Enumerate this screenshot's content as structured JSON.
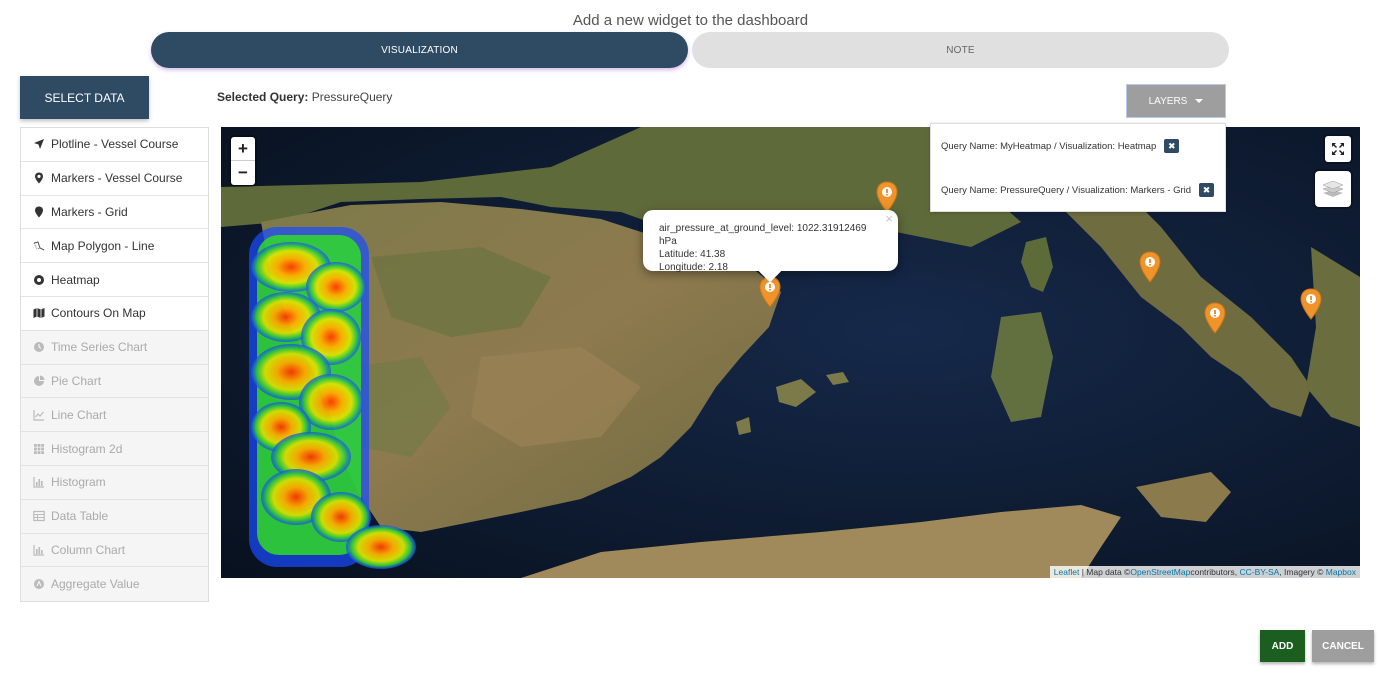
{
  "dialog": {
    "title": "Add a new widget to the dashboard"
  },
  "tabs": [
    {
      "label": "VISUALIZATION",
      "active": true
    },
    {
      "label": "NOTE",
      "active": false
    }
  ],
  "select_data_label": "SELECT DATA",
  "selected_query": {
    "label": "Selected Query:",
    "value": "PressureQuery"
  },
  "layers_button": {
    "label": "LAYERS"
  },
  "visualizations": [
    {
      "label": "Plotline - Vessel Course",
      "icon": "location-arrow-icon",
      "enabled": true
    },
    {
      "label": "Markers - Vessel Course",
      "icon": "map-marker-icon",
      "enabled": true
    },
    {
      "label": "Markers - Grid",
      "icon": "map-pin-icon",
      "enabled": true
    },
    {
      "label": "Map Polygon - Line",
      "icon": "polygon-icon",
      "enabled": true
    },
    {
      "label": "Heatmap",
      "icon": "dot-circle-icon",
      "enabled": true
    },
    {
      "label": "Contours On Map",
      "icon": "map-icon",
      "enabled": true
    },
    {
      "label": "Time Series Chart",
      "icon": "clock-icon",
      "enabled": false
    },
    {
      "label": "Pie Chart",
      "icon": "pie-chart-icon",
      "enabled": false
    },
    {
      "label": "Line Chart",
      "icon": "line-chart-icon",
      "enabled": false
    },
    {
      "label": "Histogram 2d",
      "icon": "grid-icon",
      "enabled": false
    },
    {
      "label": "Histogram",
      "icon": "bar-chart-icon",
      "enabled": false
    },
    {
      "label": "Data Table",
      "icon": "table-icon",
      "enabled": false
    },
    {
      "label": "Column Chart",
      "icon": "column-chart-icon",
      "enabled": false
    },
    {
      "label": "Aggregate Value",
      "icon": "aggregate-icon",
      "enabled": false
    }
  ],
  "map": {
    "zoom_in": "+",
    "zoom_out": "−",
    "popup": {
      "line1": "air_pressure_at_ground_level: 1022.31912469 hPa",
      "line2": "Latitude: 41.38",
      "line3": "Longitude: 2.18",
      "close": "×"
    },
    "attribution": {
      "leaflet": "Leaflet",
      "text1": " | Map data ©",
      "osm": "OpenStreetMap",
      "text2": "contributors, ",
      "license": "CC-BY-SA",
      "text3": ", Imagery © ",
      "mapbox": "Mapbox"
    }
  },
  "layers_panel": [
    {
      "label": "Query Name: MyHeatmap / Visualization: Heatmap"
    },
    {
      "label": "Query Name: PressureQuery / Visualization: Markers - Grid"
    }
  ],
  "footer": {
    "add_label": "ADD",
    "cancel_label": "CANCEL"
  },
  "colors": {
    "primary": "#2f4a63",
    "add": "#1b5e20",
    "marker": "#f0932b"
  }
}
